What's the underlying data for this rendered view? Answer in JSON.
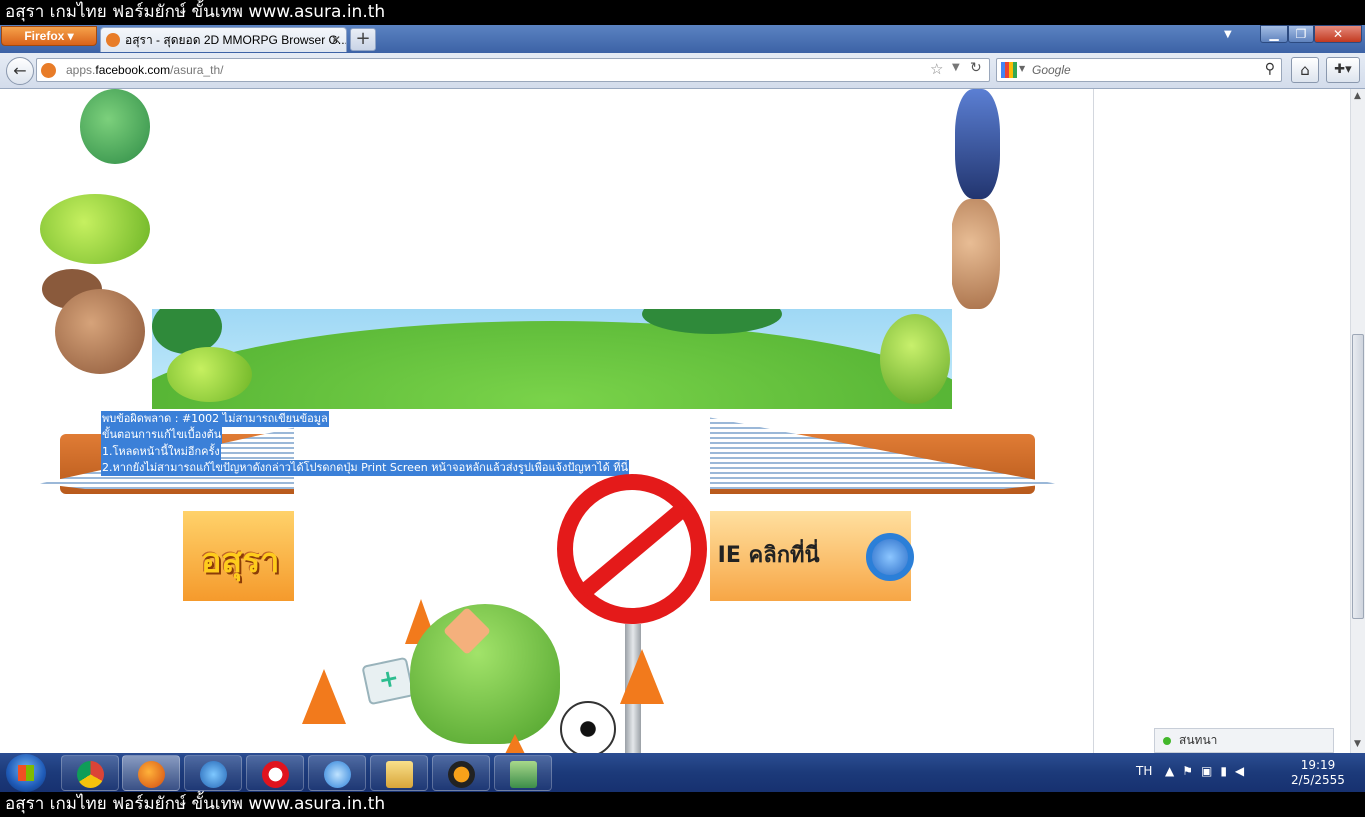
{
  "banner": {
    "text": "อสุรา เกมไทย ฟอร์มยักษ์ ขั้นเทพ www.asura.in.th"
  },
  "browser": {
    "menu_label": "Firefox",
    "tab_title": "อสุรา - สุดยอด 2D MMORPG Browser G...",
    "new_tab": "+",
    "url_host_prefix": "apps.",
    "url_domain": "facebook.com",
    "url_path": "/asura_th/",
    "search_placeholder": "Google"
  },
  "page": {
    "error_lines": [
      "พบข้อผิดพลาด : #1002 ไม่สามารถเขียนข้อมูล",
      "ขั้นตอนการแก้ไขเบื้องต้น",
      "1.โหลดหน้านี้ใหม่อีกครั้ง",
      "2.หากยังไม่สามารถแก้ไขปัญหาดังกล่าวได้โปรดกดปุ่ม Print Screen หน้าจอหลักแล้วส่งรูปเพื่อแจ้งปัญหาได้ ที่นี่"
    ],
    "logo_text": "อสุรา",
    "ie_banner_text": "ี IE คลิกที่นี่"
  },
  "chat": {
    "label": "สนทนา"
  },
  "taskbar": {
    "apps": [
      "chrome-icon",
      "firefox-icon",
      "tiling-icon",
      "opera-icon",
      "ie-icon",
      "explorer-icon",
      "avast-icon",
      "network-icon"
    ],
    "language": "TH",
    "time": "19:19",
    "date": "2/5/2555"
  }
}
